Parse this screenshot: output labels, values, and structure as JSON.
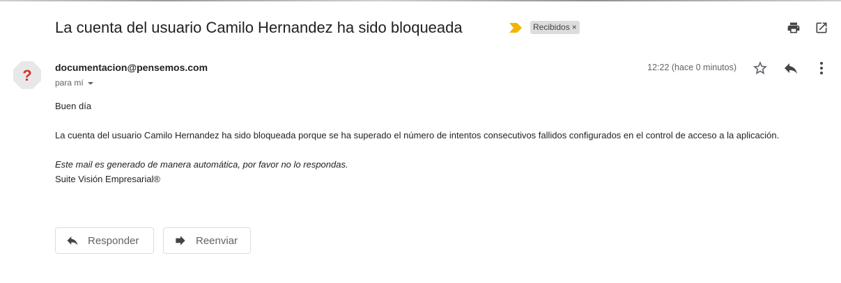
{
  "subject": "La cuenta del usuario Camilo Hernandez ha sido bloqueada",
  "label_chip": {
    "text": "Recibidos",
    "remove": "×"
  },
  "toolbar": {
    "print_icon": "print-icon",
    "open_new_window_icon": "open-in-new-icon"
  },
  "sender": {
    "email": "documentacion@pensemos.com",
    "to": "para mí",
    "avatar_icon": "unknown-sender-icon",
    "avatar_glyph": "?"
  },
  "message_meta": {
    "time": "12:22 (hace 0 minutos)",
    "star_icon": "star-icon",
    "reply_icon": "reply-icon",
    "more_icon": "more-vert-icon"
  },
  "body": {
    "greeting": "Buen día",
    "paragraph": "La cuenta del usuario Camilo Hernandez ha sido bloqueada porque se ha superado el número de intentos consecutivos fallidos configurados en el control de acceso a la aplicación.",
    "auto_note": "Este mail es generado de manera automática, por favor no lo respondas.",
    "signature": "Suite Visión Empresarial®"
  },
  "actions": {
    "reply": "Responder",
    "forward": "Reenviar"
  },
  "colors": {
    "importance": "#F4B400",
    "avatar_bg": "#E8E8E8",
    "avatar_glyph": "#D93025"
  }
}
